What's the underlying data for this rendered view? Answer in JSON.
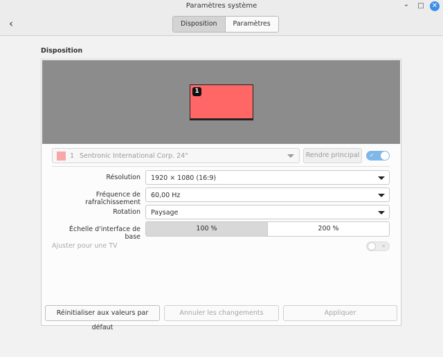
{
  "window": {
    "title": "Paramètres système",
    "back_icon": "‹",
    "minimize_icon": "⌄",
    "maximize_icon": "□",
    "close_icon": "✕"
  },
  "view_switch": {
    "tabs": [
      {
        "label": "Disposition",
        "active": true
      },
      {
        "label": "Paramètres",
        "active": false
      }
    ]
  },
  "section_title": "Disposition",
  "preview": {
    "monitor_number": "1",
    "monitor_color": "#ff6666",
    "background_color": "#8c8c8c"
  },
  "monitor_selector": {
    "number": "1",
    "name": "Sentronic International Corp. 24\"",
    "swatch_color": "#f7a7a7"
  },
  "primary_button": "Rendre principal",
  "enable_switch": {
    "state": "on",
    "mark": "✓"
  },
  "settings": {
    "resolution": {
      "label": "Résolution",
      "value": "1920 × 1080 (16:9)"
    },
    "refresh": {
      "label": "Fréquence de rafraîchissement",
      "value": "60,00 Hz"
    },
    "rotation": {
      "label": "Rotation",
      "value": "Paysage"
    },
    "scale": {
      "label": "Échelle d'interface de base",
      "options": [
        "100 %",
        "200 %"
      ],
      "selected": "100 %"
    },
    "tv": {
      "label": "Ajuster pour une TV",
      "state": "off",
      "mark": "✕"
    }
  },
  "footer": {
    "reset": "Réinitialiser aux valeurs par défaut",
    "cancel": "Annuler les changements",
    "apply": "Appliquer"
  },
  "colors": {
    "accent": "#7fb8e8",
    "close_button": "#3b8ee8"
  }
}
